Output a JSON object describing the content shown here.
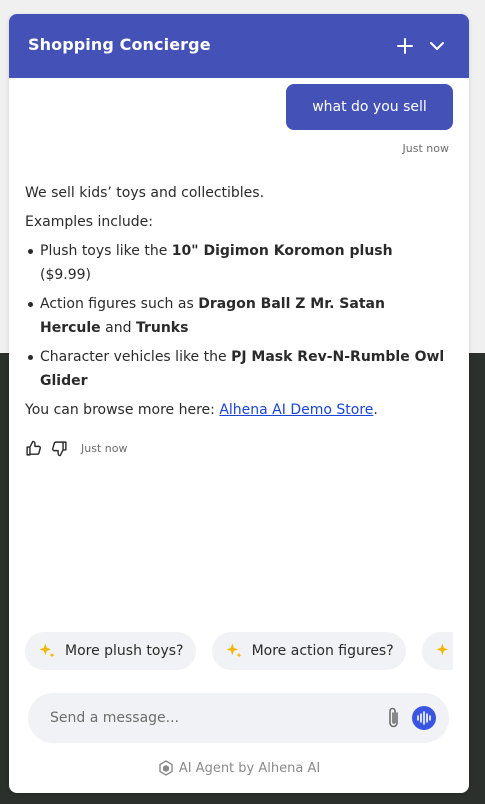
{
  "header": {
    "title": "Shopping Concierge",
    "new_chat_icon": "plus-icon",
    "minimize_icon": "chevron-down-icon"
  },
  "colors": {
    "brand": "#4452b8",
    "link": "#1a44d6",
    "sparkle": "#f2b705",
    "voice": "#3a56e0"
  },
  "user_message": {
    "text": "what do you sell",
    "time": "Just now"
  },
  "bot_message": {
    "intro": "We sell kids’ toys and collectibles.",
    "examples_label": "Examples include:",
    "items": [
      {
        "pre": "Plush toys like the ",
        "bold1": "10\" Digimon Koromon plush",
        "mid": "",
        "bold2": "",
        "post": " ($9.99)"
      },
      {
        "pre": "Action figures such as ",
        "bold1": "Dragon Ball Z Mr. Satan Hercule",
        "mid": " and ",
        "bold2": "Trunks",
        "post": ""
      },
      {
        "pre": "Character vehicles like the ",
        "bold1": "PJ Mask Rev-N-Rumble Owl Glider",
        "mid": "",
        "bold2": "",
        "post": ""
      }
    ],
    "browse_prefix": "You can browse more here: ",
    "browse_link": "Alhena AI Demo Store",
    "browse_suffix": ".",
    "time": "Just now"
  },
  "suggestions": [
    "More plush toys?",
    "More action figures?",
    ""
  ],
  "composer": {
    "placeholder": "Send a message..."
  },
  "footer": {
    "text": "AI Agent by Alhena AI"
  }
}
